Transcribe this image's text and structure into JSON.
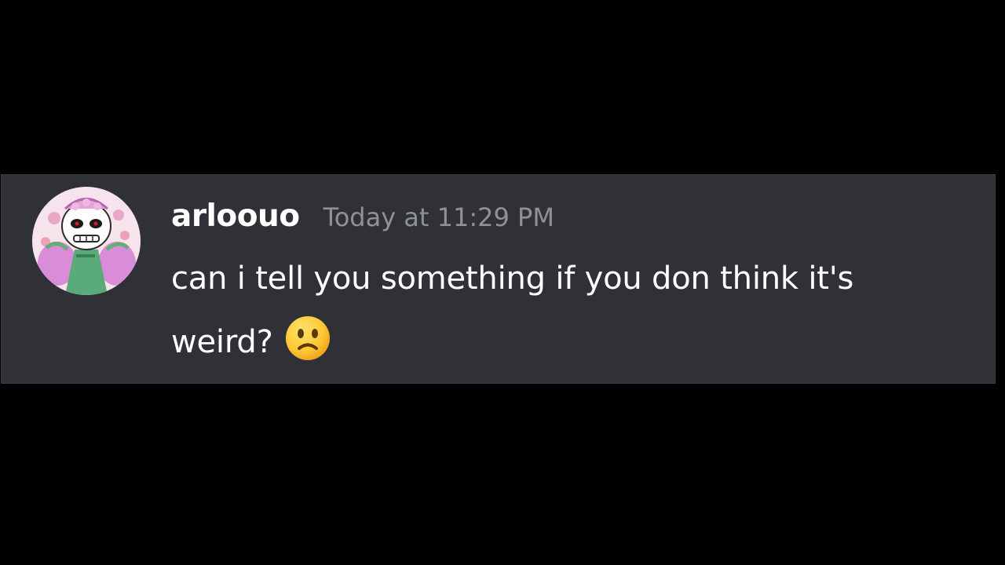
{
  "message": {
    "username": "arloouo",
    "timestamp": "Today at 11:29 PM",
    "text": "can i tell you something if you don think it's weird?",
    "emoji": "slightly-frowning-face-icon"
  },
  "colors": {
    "background": "#000000",
    "card": "#2f3136",
    "username": "#ffffff",
    "timestamp": "#8e9297",
    "text": "#ffffff"
  }
}
